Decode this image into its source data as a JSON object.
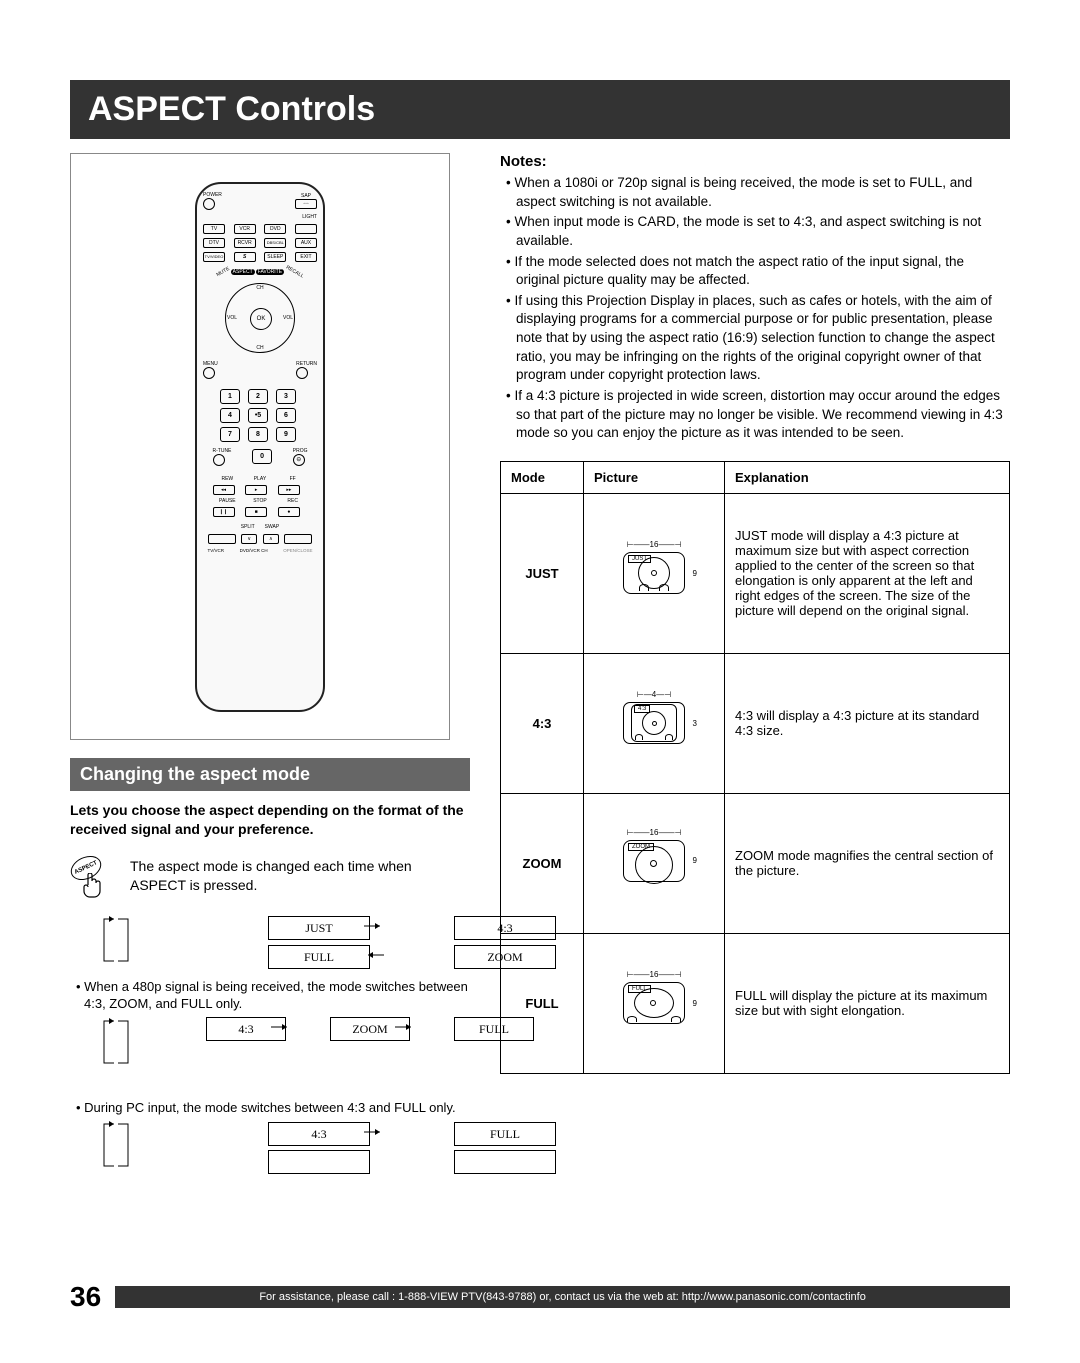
{
  "title": "ASPECT Controls",
  "remote": {
    "power": "POWER",
    "sap": "SAP",
    "light": "LIGHT",
    "row1": [
      "TV",
      "VCR",
      "DVD",
      ""
    ],
    "row2": [
      "DTV",
      "RCVR",
      "DBS/CBL",
      "AUX"
    ],
    "row3": [
      "TV/VIDEO",
      "",
      "SLEEP",
      "EXIT"
    ],
    "aspect": "ASPECT",
    "favorite": "FAVORITE",
    "mute": "MUTE",
    "recall": "RECALL",
    "ch": "CH",
    "vol_minus": "VOL",
    "vol_plus": "VOL",
    "ok": "OK",
    "menu": "MENU",
    "return": "RETURN",
    "numbers": [
      "1",
      "2",
      "3",
      "4",
      "5",
      "6",
      "7",
      "8",
      "9",
      "0"
    ],
    "rtune": "R-TUNE",
    "prog": "PROG",
    "transport": {
      "rew": "REW",
      "play": "PLAY",
      "ff": "FF",
      "pause": "PAUSE",
      "stop": "STOP",
      "rec": "REC"
    },
    "bottom": {
      "split": "SPLIT",
      "swap": "SWAP",
      "tvvcr": "TV/VCR",
      "dvdvcrch": "DVD/VCR CH",
      "openclose": "OPEN/CLOSE"
    }
  },
  "section_head": "Changing the aspect mode",
  "lead": "Lets you choose the aspect depending on the format of the received signal and your preference.",
  "press_label": "ASPECT",
  "press_text": "The aspect mode is changed each time when ASPECT is pressed.",
  "flow1": {
    "a": "JUST",
    "b": "4:3",
    "c": "FULL",
    "d": "ZOOM"
  },
  "bullet1": "• When a 480p signal is being received, the mode switches between 4:3, ZOOM, and FULL only.",
  "flow2": {
    "a": "4:3",
    "b": "ZOOM",
    "c": "FULL"
  },
  "bullet2": "• During PC input, the mode switches between 4:3 and FULL only.",
  "flow3": {
    "a": "4:3",
    "b": "FULL"
  },
  "notes_h": "Notes:",
  "notes": [
    "• When a 1080i or 720p signal is being received, the mode is set to FULL, and aspect switching is not available.",
    "• When input mode is CARD, the mode is set to 4:3, and aspect switching is not available.",
    "• If the mode selected does not match the aspect ratio of the input signal, the original picture quality may be affected.",
    "• If using this Projection Display in places, such as cafes or hotels, with the aim of displaying programs for a commercial purpose or for public presentation, please note that by using the aspect ratio (16:9) selection function to change the aspect ratio, you may be infringing on the rights of the original copyright owner of that program under copyright protection laws.",
    "• If a 4:3 picture is projected in wide screen, distortion may occur around the edges so that part of the picture may no longer be visible. We recommend viewing in 4:3 mode so you can enjoy the picture as it was intended to be seen."
  ],
  "table": {
    "head": {
      "mode": "Mode",
      "picture": "Picture",
      "expl": "Explanation"
    },
    "rows": [
      {
        "mode": "JUST",
        "pic": {
          "label": "JUST",
          "w": "16",
          "h": "9"
        },
        "expl": "JUST mode will display a 4:3 picture at maximum size but with aspect correction applied to the center of the screen so that elongation is only apparent at the left and right edges of the screen. The size of the picture will depend on the original signal."
      },
      {
        "mode": "4:3",
        "pic": {
          "label": "4:3",
          "w": "4",
          "h": "3"
        },
        "expl": "4:3 will display a 4:3 picture at its standard 4:3 size."
      },
      {
        "mode": "ZOOM",
        "pic": {
          "label": "ZOOM",
          "w": "16",
          "h": "9"
        },
        "expl": "ZOOM mode magnifies the central section of the picture."
      },
      {
        "mode": "FULL",
        "pic": {
          "label": "FULL",
          "w": "16",
          "h": "9"
        },
        "expl": "FULL will display the picture at its maximum size but with sight elongation."
      }
    ]
  },
  "page_number": "36",
  "footer": "For assistance, please call : 1-888-VIEW PTV(843-9788) or, contact us via the web at: http://www.panasonic.com/contactinfo"
}
